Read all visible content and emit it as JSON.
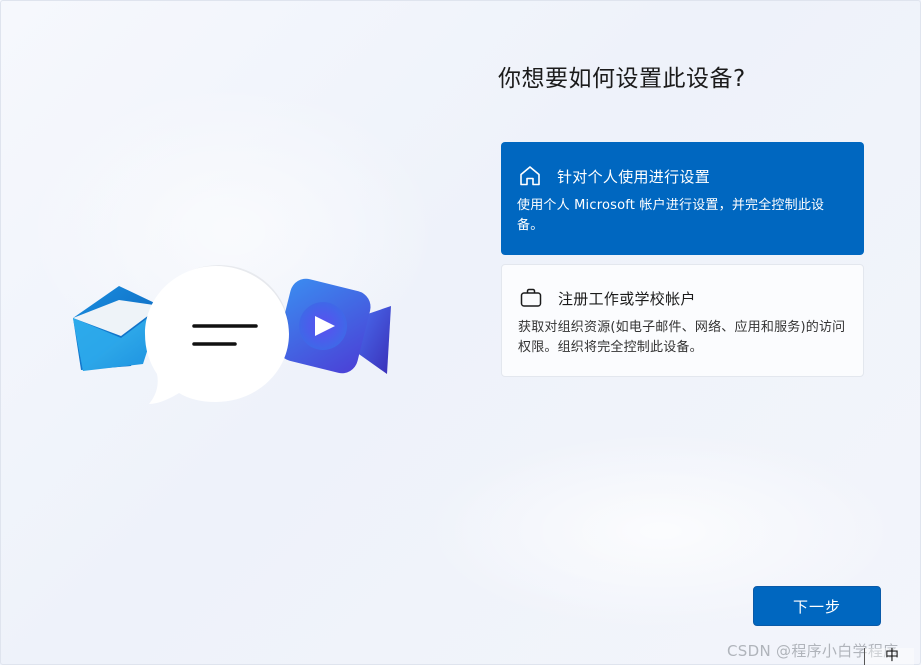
{
  "page": {
    "title": "你想要如何设置此设备?"
  },
  "options": [
    {
      "title": "针对个人使用进行设置",
      "description": "使用个人 Microsoft 帐户进行设置，并完全控制此设备。",
      "icon": "home-icon",
      "selected": true
    },
    {
      "title": "注册工作或学校帐户",
      "description": "获取对组织资源(如电子邮件、网络、应用和服务)的访问权限。组织将完全控制此设备。",
      "icon": "briefcase-icon",
      "selected": false
    }
  ],
  "footer": {
    "next_label": "下一步"
  },
  "watermark": "CSDN @程序小白学程序",
  "ime": {
    "label": "中"
  },
  "colors": {
    "accent": "#0067c0",
    "card_bg": "#fbfcfe",
    "text": "#1b1b1b"
  },
  "illustration": {
    "icons": [
      "mail-icon",
      "chat-bubble-icon",
      "video-camera-icon"
    ]
  }
}
